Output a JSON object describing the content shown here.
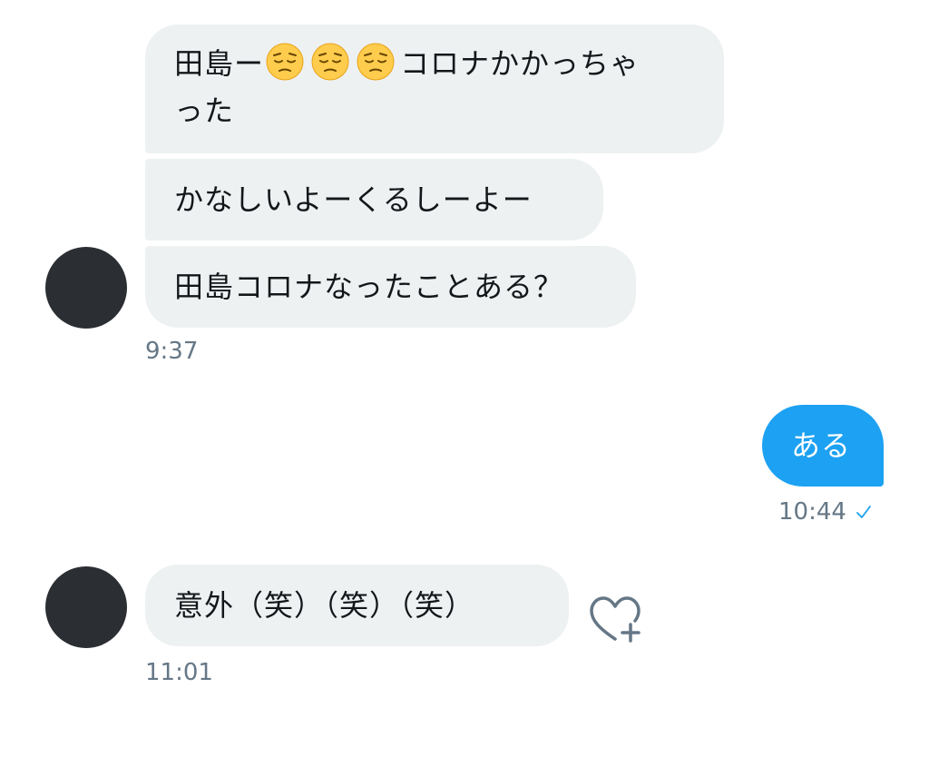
{
  "conversation": {
    "group1": {
      "msg1_start": "田島ー",
      "msg1_mid": "コロナかかっちゃ",
      "msg1_end": "った",
      "msg2": "かなしいよーくるしーよー",
      "msg3": "田島コロナなったことある？",
      "time": "9:37"
    },
    "outgoing": {
      "msg": "ある",
      "time": "10:44"
    },
    "group2": {
      "msg": "意外（笑）（笑）（笑）",
      "time": "11:01"
    }
  },
  "icons": {
    "emoji": "pensive-face-emoji",
    "read_receipt": "checkmark-icon",
    "like": "heart-plus-icon"
  },
  "colors": {
    "incoming_bubble": "#eef1f2",
    "outgoing_bubble": "#1da1f2",
    "timestamp": "#657786",
    "avatar": "#2b2e33",
    "check": "#1da1f2"
  }
}
